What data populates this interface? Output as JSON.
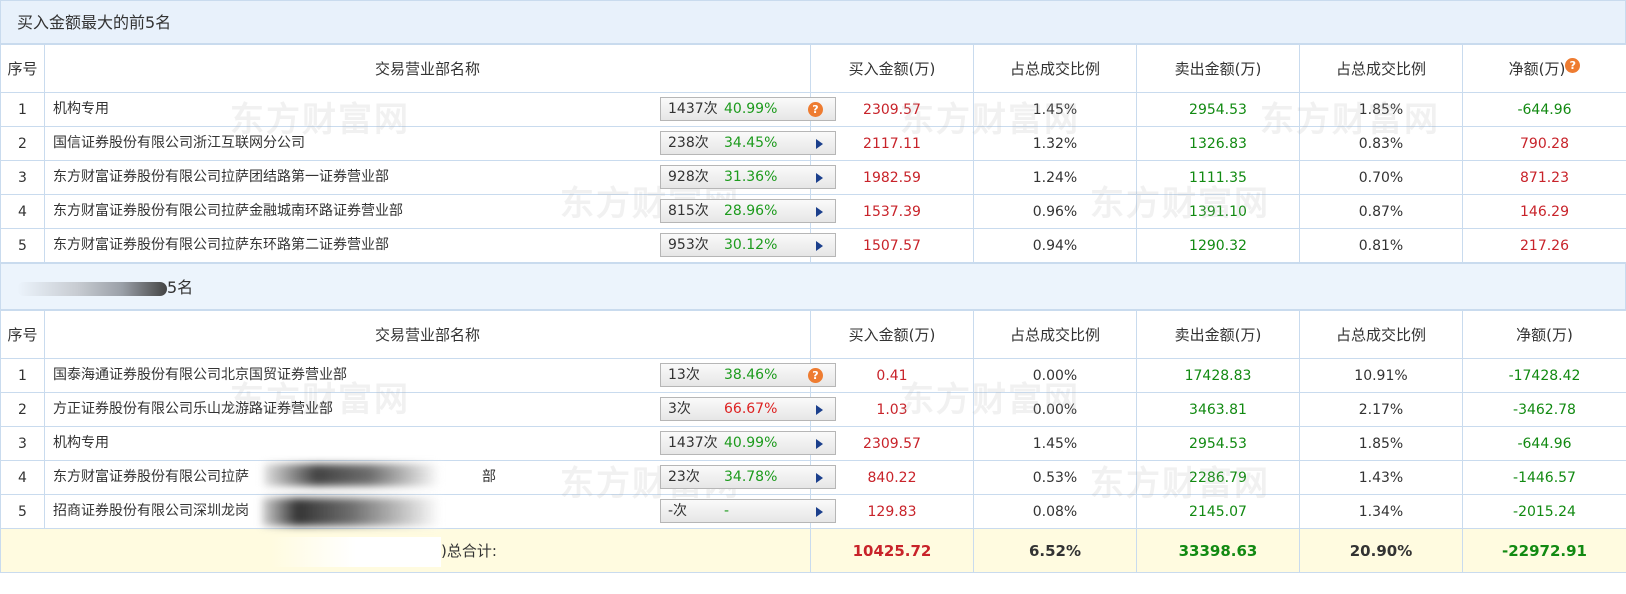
{
  "top_buy": {
    "title": "买入金额最大的前5名",
    "headers": {
      "idx": "序号",
      "name": "交易营业部名称",
      "buy": "买入金额(万)",
      "buy_ratio": "占总成交比例",
      "sell": "卖出金额(万)",
      "sell_ratio": "占总成交比例",
      "net": "净额(万)"
    },
    "rows": [
      {
        "idx": "1",
        "name": "机构专用",
        "count": "1437次",
        "rate": "40.99%",
        "buy": "2309.57",
        "buy_ratio": "1.45%",
        "sell": "2954.53",
        "sell_ratio": "1.85%",
        "net": "-644.96"
      },
      {
        "idx": "2",
        "name": "国信证券股份有限公司浙江互联网分公司",
        "count": "238次",
        "rate": "34.45%",
        "buy": "2117.11",
        "buy_ratio": "1.32%",
        "sell": "1326.83",
        "sell_ratio": "0.83%",
        "net": "790.28"
      },
      {
        "idx": "3",
        "name": "东方财富证券股份有限公司拉萨团结路第一证券营业部",
        "count": "928次",
        "rate": "31.36%",
        "buy": "1982.59",
        "buy_ratio": "1.24%",
        "sell": "1111.35",
        "sell_ratio": "0.70%",
        "net": "871.23"
      },
      {
        "idx": "4",
        "name": "东方财富证券股份有限公司拉萨金融城南环路证券营业部",
        "count": "815次",
        "rate": "28.96%",
        "buy": "1537.39",
        "buy_ratio": "0.96%",
        "sell": "1391.10",
        "sell_ratio": "0.87%",
        "net": "146.29"
      },
      {
        "idx": "5",
        "name": "东方财富证券股份有限公司拉萨东环路第二证券营业部",
        "count": "953次",
        "rate": "30.12%",
        "buy": "1507.57",
        "buy_ratio": "0.94%",
        "sell": "1290.32",
        "sell_ratio": "0.81%",
        "net": "217.26"
      }
    ]
  },
  "top_sell": {
    "title": "5名",
    "headers": {
      "idx": "序号",
      "name": "交易营业部名称",
      "buy": "买入金额(万)",
      "buy_ratio": "占总成交比例",
      "sell": "卖出金额(万)",
      "sell_ratio": "占总成交比例",
      "net": "净额(万)"
    },
    "rows": [
      {
        "idx": "1",
        "name": "国泰海通证券股份有限公司北京国贸证券营业部",
        "count": "13次",
        "rate": "38.46%",
        "buy": "0.41",
        "buy_ratio": "0.00%",
        "sell": "17428.83",
        "sell_ratio": "10.91%",
        "net": "-17428.42"
      },
      {
        "idx": "2",
        "name": "方正证券股份有限公司乐山龙游路证券营业部",
        "count": "3次",
        "rate": "66.67%",
        "buy": "1.03",
        "buy_ratio": "0.00%",
        "sell": "3463.81",
        "sell_ratio": "2.17%",
        "net": "-3462.78"
      },
      {
        "idx": "3",
        "name": "机构专用",
        "count": "1437次",
        "rate": "40.99%",
        "buy": "2309.57",
        "buy_ratio": "1.45%",
        "sell": "2954.53",
        "sell_ratio": "1.85%",
        "net": "-644.96"
      },
      {
        "idx": "4",
        "name": "东方财富证券股份有限公司拉萨",
        "name_tail": "部",
        "count": "23次",
        "rate": "34.78%",
        "buy": "840.22",
        "buy_ratio": "0.53%",
        "sell": "2286.79",
        "sell_ratio": "1.43%",
        "net": "-1446.57"
      },
      {
        "idx": "5",
        "name": "招商证券股份有限公司深圳龙岗",
        "count": "-次",
        "rate": "-",
        "buy": "129.83",
        "buy_ratio": "0.08%",
        "sell": "2145.07",
        "sell_ratio": "1.34%",
        "net": "-2015.24"
      }
    ],
    "total": {
      "label": ")总合计:",
      "buy": "10425.72",
      "buy_ratio": "6.52%",
      "sell": "33398.63",
      "sell_ratio": "20.90%",
      "net": "-22972.91"
    }
  },
  "icons": {
    "help": "help-icon",
    "arrow": "play-arrow-icon"
  },
  "colors": {
    "red": "#c8232a",
    "green": "#128a12",
    "header_bg": "#e8f1fb",
    "total_bg": "#fffbe0"
  }
}
